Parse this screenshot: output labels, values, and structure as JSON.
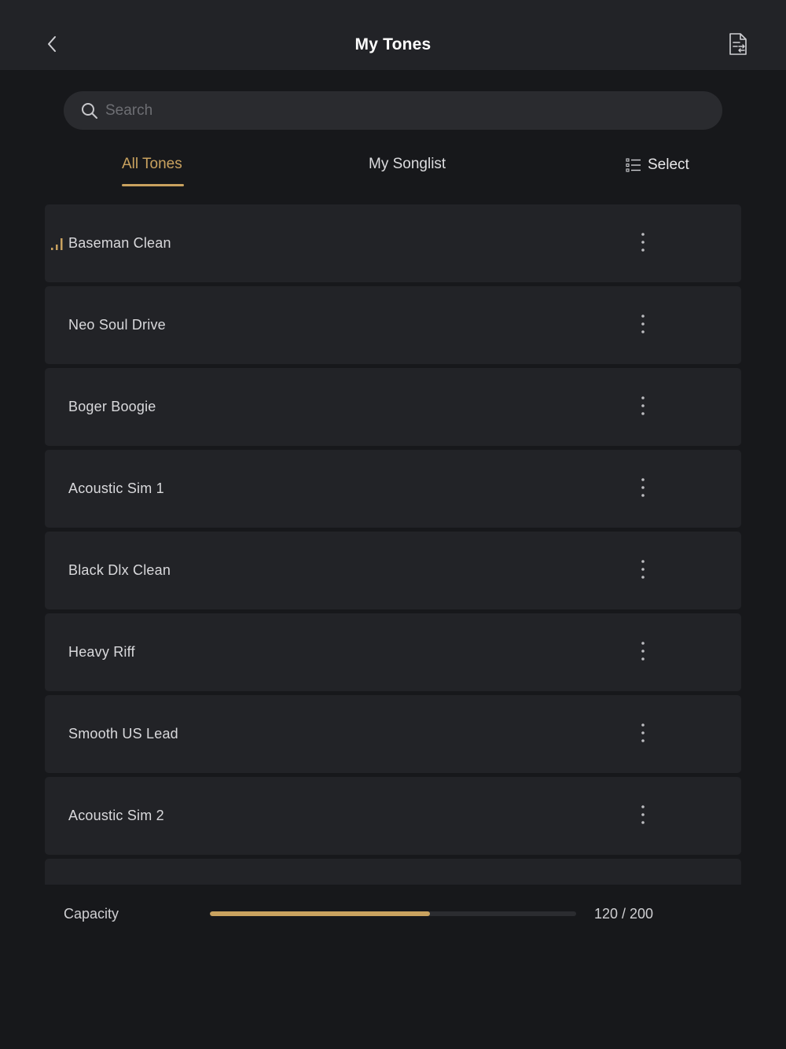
{
  "header": {
    "title": "My Tones",
    "back_icon": "chevron-left-icon",
    "action_icon": "document-swap-icon"
  },
  "search": {
    "placeholder": "Search",
    "value": ""
  },
  "tabs": [
    {
      "label": "All Tones",
      "active": true
    },
    {
      "label": "My Songlist",
      "active": false
    }
  ],
  "select": {
    "label": "Select",
    "icon": "numbered-list-icon"
  },
  "tones": [
    {
      "name": "Baseman Clean",
      "playing": true
    },
    {
      "name": "Neo Soul Drive",
      "playing": false
    },
    {
      "name": "Boger Boogie",
      "playing": false
    },
    {
      "name": "Acoustic Sim 1",
      "playing": false
    },
    {
      "name": "Black Dlx Clean",
      "playing": false
    },
    {
      "name": "Heavy Riff",
      "playing": false
    },
    {
      "name": "Smooth US Lead",
      "playing": false
    },
    {
      "name": "Acoustic Sim 2",
      "playing": false
    }
  ],
  "capacity": {
    "label": "Capacity",
    "used": 120,
    "total": 200,
    "text": "120 / 200",
    "fraction": 0.6
  },
  "colors": {
    "accent": "#c9a25f",
    "background": "#17181b",
    "surface": "#222327"
  }
}
